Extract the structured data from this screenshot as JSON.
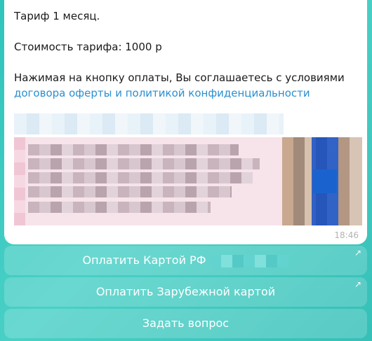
{
  "message": {
    "line1": "Тариф 1 месяц.",
    "line2": "Стоимость тарифа: 1000 р",
    "line3": "Нажимая на кнопку оплаты, Вы соглашаетесь с условиями",
    "link_text": "договора оферты и политикой конфиденциальности",
    "time": "18:46"
  },
  "keyboard": {
    "buttons": [
      {
        "label": "Оплатить Картой РФ"
      },
      {
        "label": "Оплатить Зарубежной картой"
      },
      {
        "label": "Задать вопрос"
      }
    ],
    "link_arrow_icon": "arrow-up-right-icon"
  },
  "colors": {
    "background": "#35c0b8",
    "link": "#2a8fd0",
    "bubble": "#ffffff"
  }
}
